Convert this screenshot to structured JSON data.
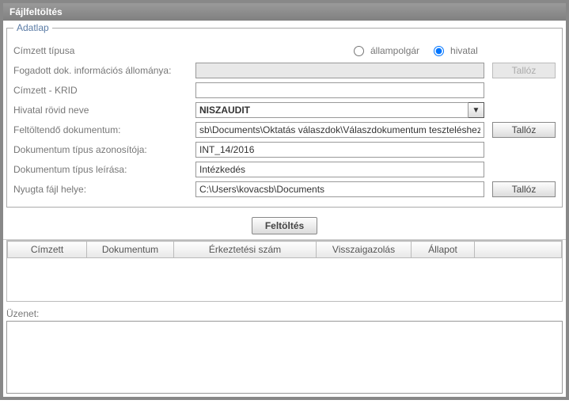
{
  "title": "Fájlfeltöltés",
  "fieldset_legend": "Adatlap",
  "labels": {
    "cimzett_tipusa": "Címzett típusa",
    "fogadott_dok": "Fogadott dok. információs állománya:",
    "cimzett_krid": "Címzett - KRID",
    "hivatal_rovid": "Hivatal rövid neve",
    "feltoltendo": "Feltöltendő dokumentum:",
    "dok_tipus_azon": "Dokumentum típus azonosítója:",
    "dok_tipus_leiras": "Dokumentum típus leírása:",
    "nyugta_helye": "Nyugta fájl helye:"
  },
  "radios": {
    "allampolgar": "állampolgár",
    "hivatal": "hivatal"
  },
  "values": {
    "fogadott_dok": "",
    "cimzett_krid": "",
    "hivatal_rovid": "NISZAUDIT",
    "feltoltendo": "sb\\Documents\\Oktatás válaszdok\\Válaszdokumentum teszteléshez.docx",
    "dok_tipus_azon": "INT_14/2016",
    "dok_tipus_leiras": "Intézkedés",
    "nyugta_helye": "C:\\Users\\kovacsb\\Documents"
  },
  "buttons": {
    "talloz": "Tallóz",
    "feltoltes": "Feltöltés"
  },
  "table": {
    "headers": [
      "Címzett",
      "Dokumentum",
      "Érkeztetési szám",
      "Visszaigazolás",
      "Állapot"
    ]
  },
  "uzenet_label": "Üzenet:"
}
